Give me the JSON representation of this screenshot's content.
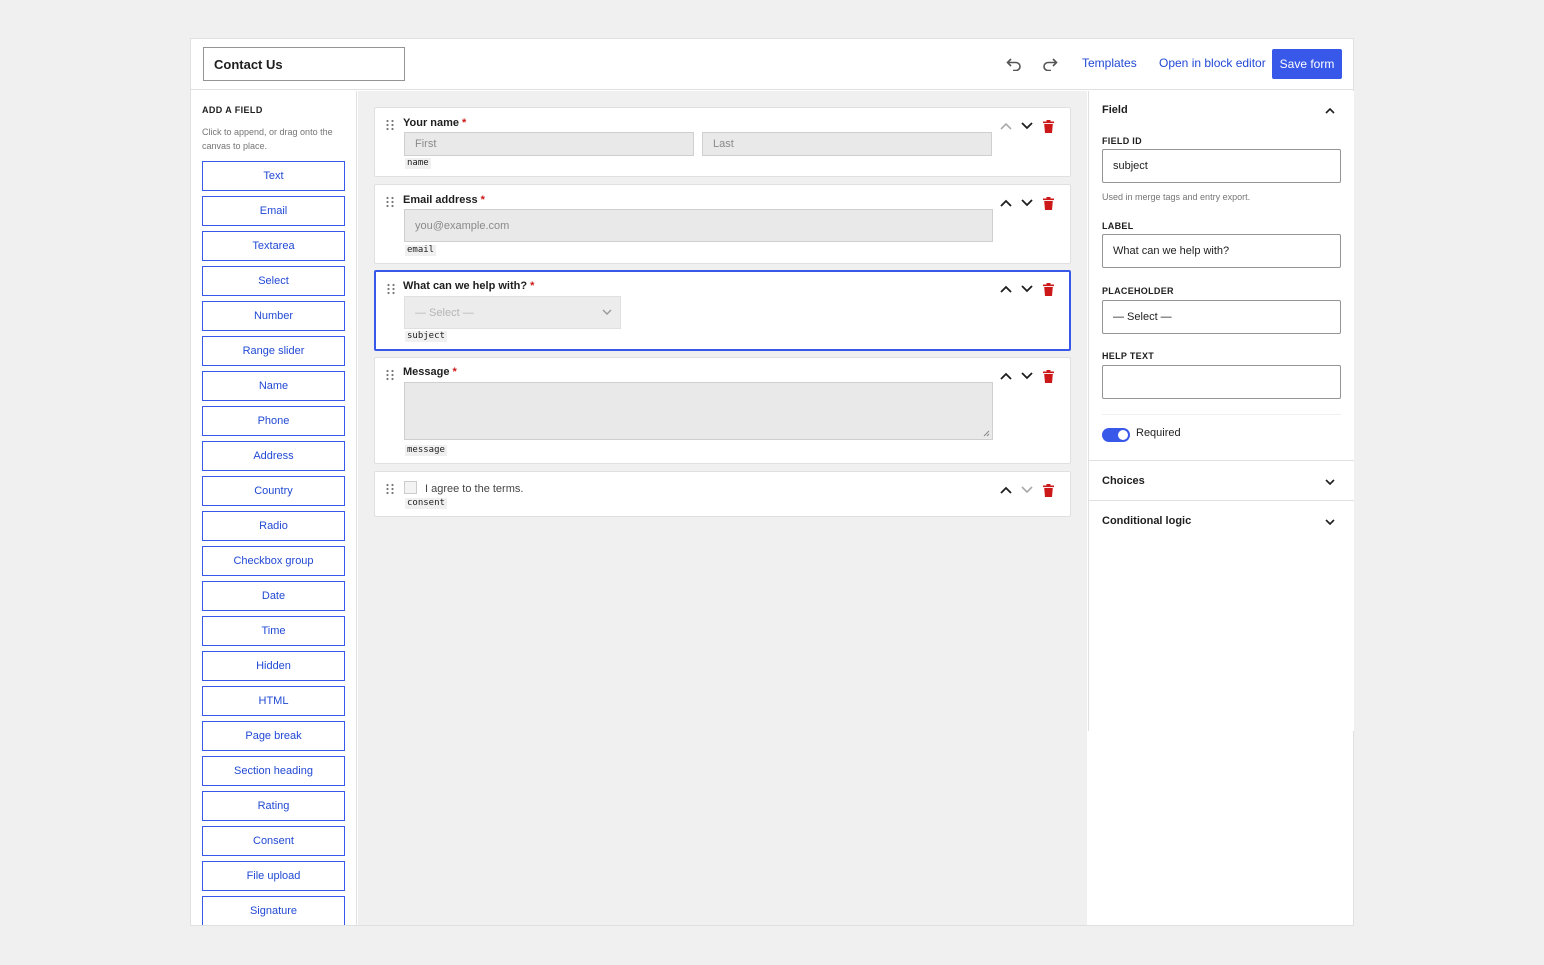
{
  "header": {
    "form_title": "Contact Us",
    "undo_icon": "undo-icon",
    "redo_icon": "redo-icon",
    "templates_label": "Templates",
    "block_editor_label": "Open in block editor",
    "save_label": "Save form"
  },
  "palette": {
    "heading": "ADD A FIELD",
    "hint": "Click to append, or drag onto the canvas to place.",
    "items": [
      "Text",
      "Email",
      "Textarea",
      "Select",
      "Number",
      "Range slider",
      "Name",
      "Phone",
      "Address",
      "Country",
      "Radio",
      "Checkbox group",
      "Date",
      "Time",
      "Hidden",
      "HTML",
      "Page break",
      "Section heading",
      "Rating",
      "Consent",
      "File upload",
      "Signature"
    ]
  },
  "canvas": {
    "fields": [
      {
        "label": "Your name",
        "required": "*",
        "first_placeholder": "First",
        "last_placeholder": "Last",
        "id": "name"
      },
      {
        "label": "Email address",
        "required": "*",
        "placeholder": "you@example.com",
        "id": "email"
      },
      {
        "label": "What can we help with?",
        "required": "*",
        "placeholder": "— Select —",
        "id": "subject",
        "selected": true
      },
      {
        "label": "Message",
        "required": "*",
        "id": "message"
      },
      {
        "label": "I agree to the terms.",
        "id": "consent"
      }
    ]
  },
  "inspector": {
    "field_section": "Field",
    "field_id_label": "FIELD ID",
    "field_id_value": "subject",
    "field_id_help": "Used in merge tags and entry export.",
    "label_label": "LABEL",
    "label_value": "What can we help with?",
    "placeholder_label": "PLACEHOLDER",
    "placeholder_value": "— Select —",
    "help_text_label": "HELP TEXT",
    "help_text_value": "",
    "required_label": "Required",
    "required_on": true,
    "choices_section": "Choices",
    "conditional_section": "Conditional logic"
  },
  "colors": {
    "accent": "#3858e9",
    "link": "#2149d4",
    "danger": "#cc1818",
    "required": "#cc1818"
  }
}
